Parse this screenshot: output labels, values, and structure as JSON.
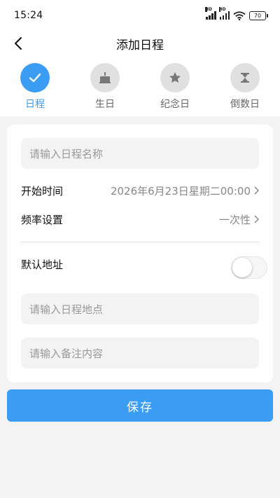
{
  "status_bar": {
    "time": "15:24",
    "signal_label": "HD",
    "battery": "70"
  },
  "nav": {
    "title": "添加日程",
    "back_icon": "chevron-left-icon"
  },
  "tabs": [
    {
      "label": "日程",
      "icon": "check-icon",
      "active": true
    },
    {
      "label": "生日",
      "icon": "cake-icon",
      "active": false
    },
    {
      "label": "纪念日",
      "icon": "star-icon",
      "active": false
    },
    {
      "label": "倒数日",
      "icon": "hourglass-icon",
      "active": false
    }
  ],
  "form": {
    "name_placeholder": "请输入日程名称",
    "start_time_label": "开始时间",
    "start_time_value": "2026年6月23日星期二00:00",
    "frequency_label": "频率设置",
    "frequency_value": "一次性",
    "default_address_label": "默认地址",
    "default_address_enabled": false,
    "location_placeholder": "请输入日程地点",
    "note_placeholder": "请输入备注内容"
  },
  "save_label": "保存",
  "colors": {
    "accent": "#3a9cf2",
    "background": "#f3f3f3",
    "inactive_icon_bg": "#e0e0e0"
  }
}
